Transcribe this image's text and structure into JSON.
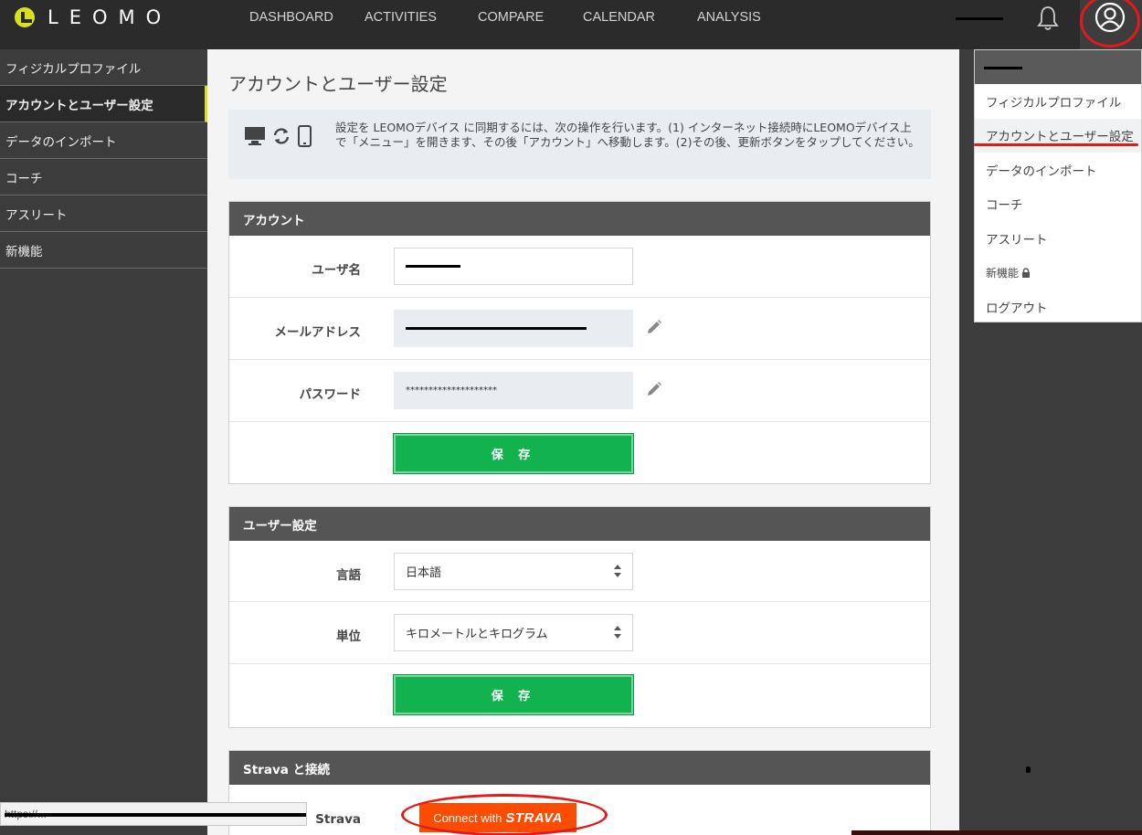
{
  "app": {
    "logo_text": "LEOMO",
    "brand_color": "#d8e21c"
  },
  "nav": [
    "DASHBOARD",
    "ACTIVITIES",
    "COMPARE",
    "CALENDAR",
    "ANALYSIS"
  ],
  "header": {
    "icons": [
      "bell-icon",
      "user-circle-icon"
    ]
  },
  "sidebar": {
    "items": [
      {
        "label": "フィジカルプロファイル"
      },
      {
        "label": "アカウントとユーザー設定",
        "active": true
      },
      {
        "label": "データのインポート"
      },
      {
        "label": "コーチ"
      },
      {
        "label": "アスリート"
      },
      {
        "label": "新機能"
      }
    ]
  },
  "page": {
    "title": "アカウントとユーザー設定",
    "sync_text": "設定を LEOMOデバイス に同期するには、次の操作を行います。(1) インターネット接続時にLEOMOデバイス上で「メニュー」を開きます、その後「アカウント」へ移動します。(2)その後、更新ボタンをタップしてください。",
    "sync_icons": [
      "monitor-icon",
      "sync-icon",
      "phone-icon"
    ]
  },
  "account": {
    "header": "アカウント",
    "username_label": "ユーザ名",
    "email_label": "メールアドレス",
    "password_label": "パスワード",
    "password_value": "********************",
    "save_label": "保 存"
  },
  "user_settings": {
    "header": "ユーザー設定",
    "language_label": "言語",
    "language_value": "日本語",
    "unit_label": "単位",
    "unit_value": "キロメートルとキログラム",
    "save_label": "保 存"
  },
  "strava": {
    "header": "Strava と接続",
    "label": "Strava",
    "button_prefix": "Connect with",
    "button_brand": "STRAVA",
    "button_color": "#fc4c02"
  },
  "dropdown": {
    "items": [
      {
        "label": "フィジカルプロファイル"
      },
      {
        "label": "アカウントとユーザー設定",
        "active": true
      },
      {
        "label": "データのインポート"
      },
      {
        "label": "コーチ"
      },
      {
        "label": "アスリート"
      },
      {
        "label": "新機能"
      },
      {
        "label": "ログアウト"
      }
    ]
  },
  "annotation_color": "#e21a1a",
  "statusbar": {
    "text": "https://..."
  }
}
